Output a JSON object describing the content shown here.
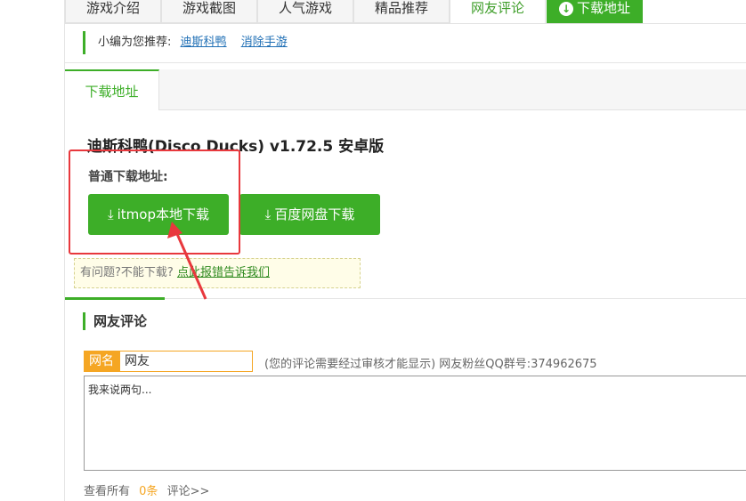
{
  "top_tabs": {
    "items": [
      {
        "label": "游戏介绍"
      },
      {
        "label": "游戏截图"
      },
      {
        "label": "人气游戏"
      },
      {
        "label": "精品推荐"
      },
      {
        "label": "网友评论"
      },
      {
        "label": "下载地址"
      }
    ]
  },
  "recommend": {
    "prefix": "小编为您推荐:",
    "links": [
      "迪斯科鸭",
      "消除手游"
    ]
  },
  "download": {
    "tab_label": "下载地址",
    "game_title": "迪斯科鸭(Disco Ducks) v1.72.5 安卓版",
    "normal_label": "普通下载地址:",
    "local_btn": "itmop本地下载",
    "baidu_btn": "百度网盘下载",
    "problem_text": "有问题?不能下载?",
    "problem_link": "点此报错告诉我们"
  },
  "comments": {
    "title": "网友评论",
    "name_label": "网名",
    "name_value": "网友",
    "note": "(您的评论需要经过审核才能显示) 网友粉丝QQ群号:374962675",
    "placeholder": "我来说两句...",
    "view_prefix": "查看所有",
    "count": "0条",
    "view_suffix": "评论>>"
  },
  "colors": {
    "accent": "#3dae28",
    "highlight": "#e8383d",
    "orange": "#f5a623"
  },
  "icons": {
    "download": "download-icon"
  }
}
